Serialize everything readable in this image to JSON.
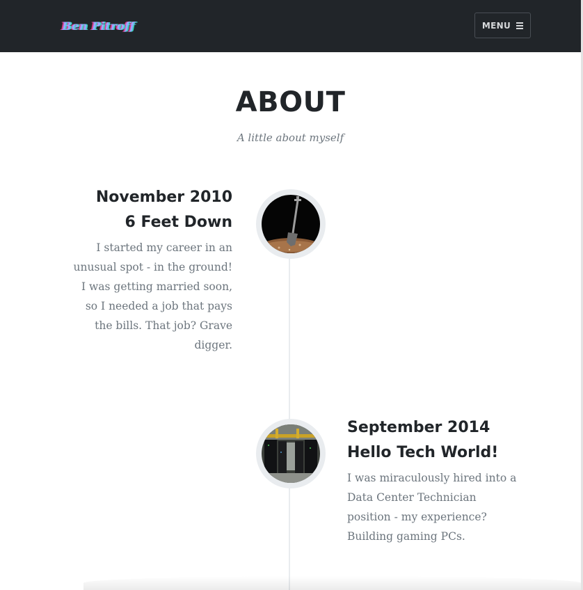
{
  "nav": {
    "brand": "Ben Pitroff",
    "menu_label": "MENU",
    "menu_icon": "hamburger-icon"
  },
  "header": {
    "title": "ABOUT",
    "subtitle": "A little about myself"
  },
  "timeline": [
    {
      "date": "November 2010",
      "title": "6 Feet Down",
      "body": "I started my career in an unusual spot - in the ground! I was getting married soon, so I needed a job that pays the bills. That job? Grave digger.",
      "image": "shovel-in-dirt-image"
    },
    {
      "date": "September 2014",
      "title": "Hello Tech World!",
      "body": "I was miraculously hired into a Data Center Technician position - my experience? Building gaming PCs.",
      "image": "data-center-image"
    }
  ],
  "colors": {
    "navbar": "#212529",
    "heading": "#212529",
    "muted_text": "#6c757d",
    "timeline": "#e9ecef"
  }
}
